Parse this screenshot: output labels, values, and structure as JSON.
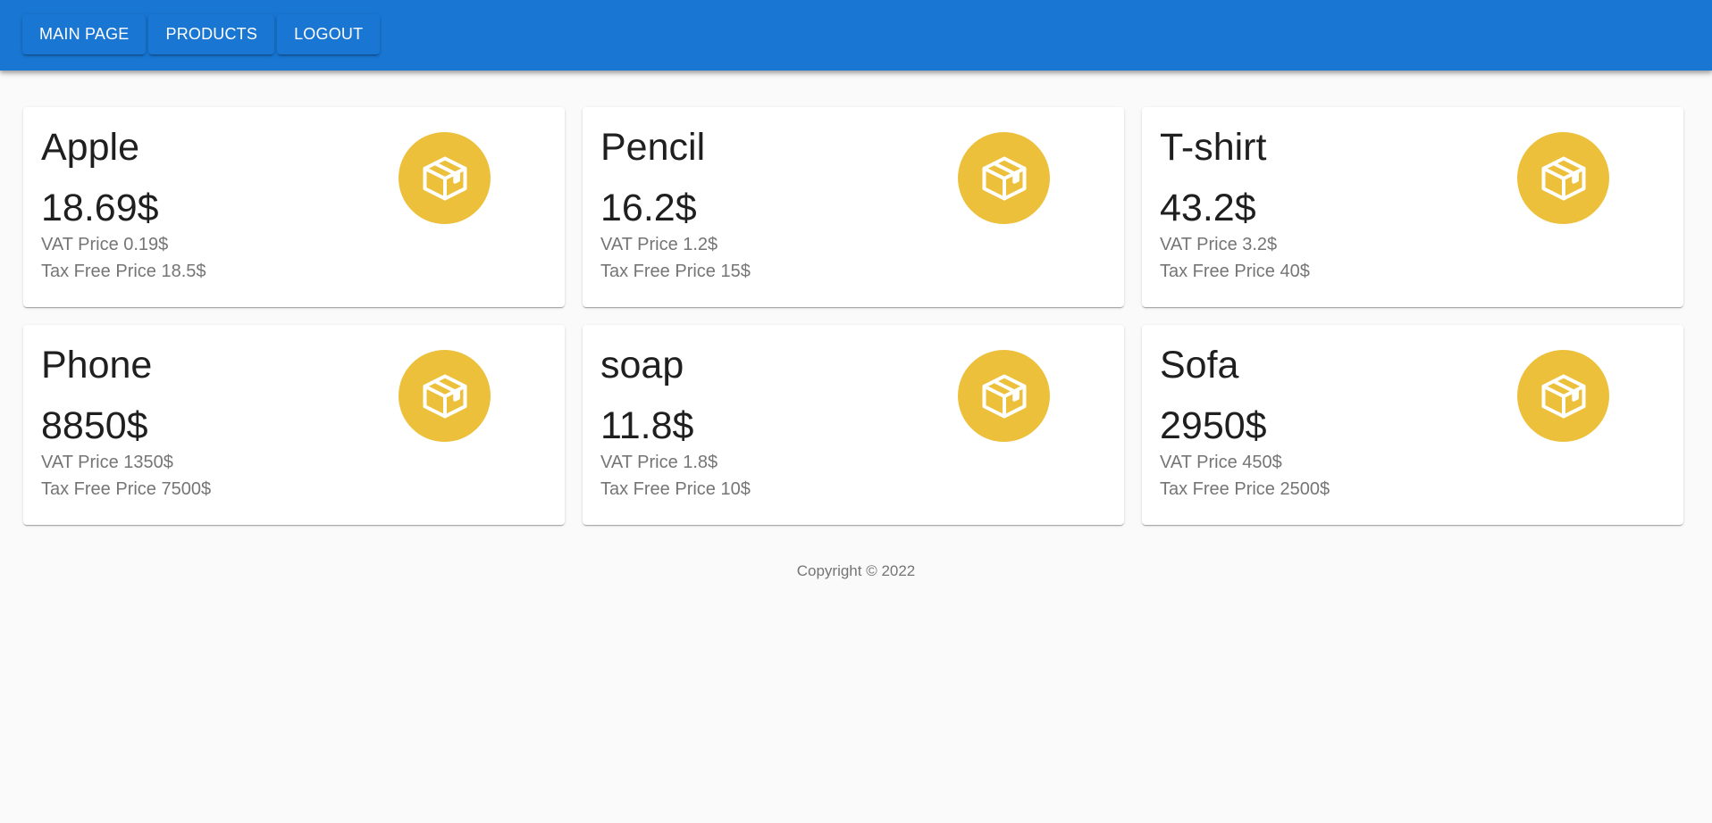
{
  "nav": {
    "items": [
      {
        "label": "MAIN PAGE"
      },
      {
        "label": "PRODUCTS"
      },
      {
        "label": "LOGOUT"
      }
    ]
  },
  "colors": {
    "primary": "#1976d2",
    "icon_bg": "#ecc03a",
    "background": "#fafafa"
  },
  "products": [
    {
      "name": "Apple",
      "price": "18.69$",
      "vat": "VAT Price 0.19$",
      "tax_free": "Tax Free Price 18.5$",
      "icon": "package-icon"
    },
    {
      "name": "Pencil",
      "price": "16.2$",
      "vat": "VAT Price 1.2$",
      "tax_free": "Tax Free Price 15$",
      "icon": "package-icon"
    },
    {
      "name": "T-shirt",
      "price": "43.2$",
      "vat": "VAT Price 3.2$",
      "tax_free": "Tax Free Price 40$",
      "icon": "package-icon"
    },
    {
      "name": "Phone",
      "price": "8850$",
      "vat": "VAT Price 1350$",
      "tax_free": "Tax Free Price 7500$",
      "icon": "package-icon"
    },
    {
      "name": "soap",
      "price": "11.8$",
      "vat": "VAT Price 1.8$",
      "tax_free": "Tax Free Price 10$",
      "icon": "package-icon"
    },
    {
      "name": "Sofa",
      "price": "2950$",
      "vat": "VAT Price 450$",
      "tax_free": "Tax Free Price 2500$",
      "icon": "package-icon"
    }
  ],
  "footer": {
    "copyright": "Copyright © 2022"
  }
}
